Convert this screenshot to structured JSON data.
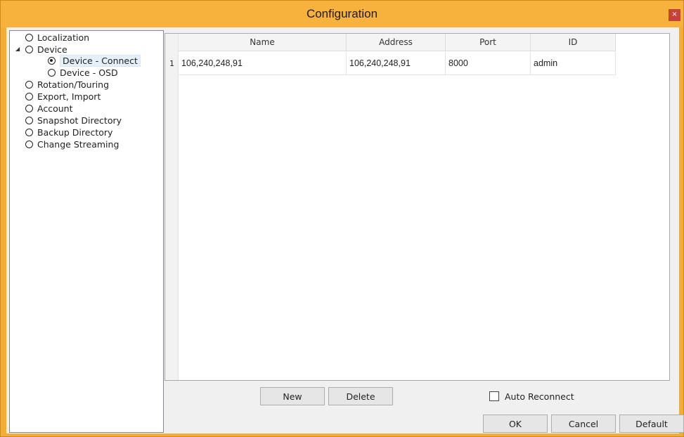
{
  "window": {
    "title": "Configuration",
    "close_label": "×",
    "title_color": "#f6b23d"
  },
  "tree": {
    "items": [
      {
        "label": "Localization",
        "checked": false
      },
      {
        "label": "Device",
        "checked": false,
        "expanded": true
      },
      {
        "label": "Device - Connect",
        "checked": true,
        "selected": true
      },
      {
        "label": "Device - OSD",
        "checked": false
      },
      {
        "label": "Rotation/Touring",
        "checked": false
      },
      {
        "label": "Export, Import",
        "checked": false
      },
      {
        "label": "Account",
        "checked": false
      },
      {
        "label": "Snapshot Directory",
        "checked": false
      },
      {
        "label": "Backup Directory",
        "checked": false
      },
      {
        "label": "Change Streaming",
        "checked": false
      }
    ],
    "expander_glyph": "◢"
  },
  "grid": {
    "columns": [
      "Name",
      "Address",
      "Port",
      "ID"
    ],
    "rows": [
      {
        "num": "1",
        "name": "106,240,248,91",
        "address": "106,240,248,91",
        "port": "8000",
        "id": "admin"
      }
    ]
  },
  "actions": {
    "new_label": "New",
    "delete_label": "Delete",
    "auto_reconnect_label": "Auto Reconnect",
    "auto_reconnect_checked": false
  },
  "footer": {
    "ok_label": "OK",
    "cancel_label": "Cancel",
    "default_label": "Default"
  }
}
